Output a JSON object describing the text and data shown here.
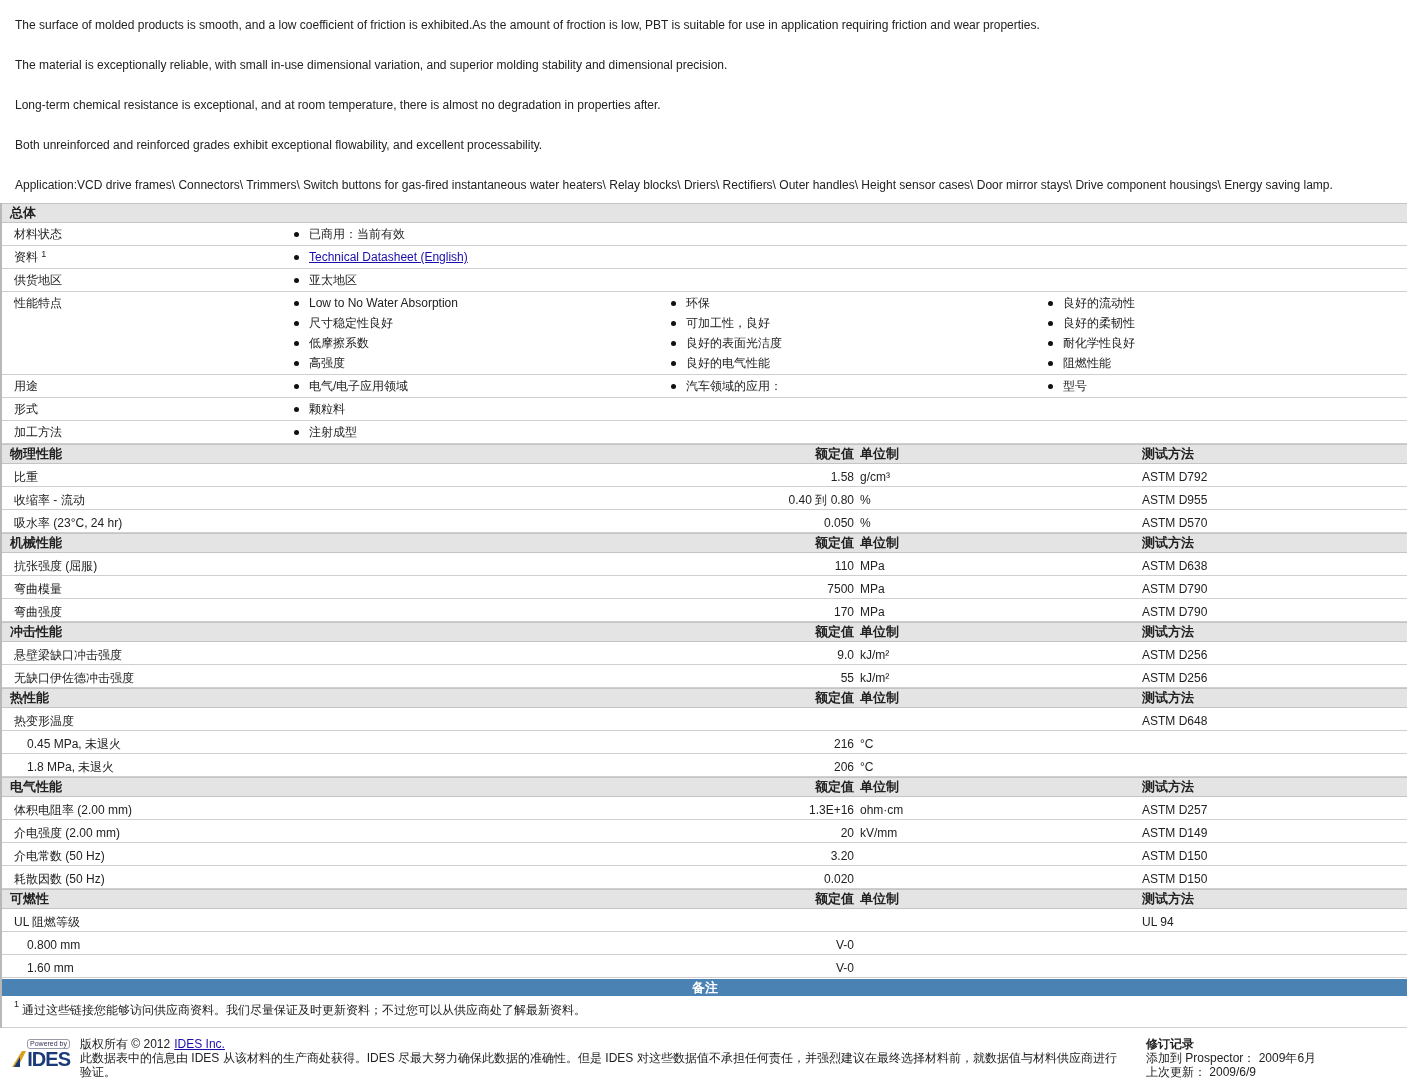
{
  "paragraphs": [
    "The surface of molded products is smooth, and a low coefficient of friction is exhibited.As the amount of froction is low, PBT is suitable for use in application requiring friction and wear properties.",
    "The material is exceptionally reliable, with small in-use dimensional variation, and superior molding stability and dimensional precision.",
    "Long-term chemical resistance is exceptional, and at room temperature, there is almost no degradation in properties after.",
    "Both unreinforced and reinforced grades exhibit exceptional flowability, and excellent processability.",
    "Application:VCD drive frames\\ Connectors\\ Trimmers\\ Switch buttons for gas-fired instantaneous water heaters\\ Relay blocks\\ Driers\\ Rectifiers\\ Outer handles\\ Height sensor cases\\ Door mirror stays\\ Drive component housings\\ Energy saving lamp."
  ],
  "general": {
    "title": "总体",
    "rows": [
      {
        "label": "材料状态",
        "columns": [
          [
            {
              "kind": "text",
              "text": "已商用：当前有效"
            }
          ]
        ]
      },
      {
        "label": "资料 $^{1}$",
        "columns": [
          [
            {
              "kind": "link",
              "text": "Technical Datasheet (English)"
            }
          ]
        ]
      },
      {
        "label": "供货地区",
        "columns": [
          [
            {
              "kind": "text",
              "text": "亚太地区"
            }
          ]
        ]
      },
      {
        "label": "性能特点",
        "columns": [
          [
            {
              "kind": "text",
              "text": "Low to No Water Absorption"
            },
            {
              "kind": "text",
              "text": "尺寸稳定性良好"
            },
            {
              "kind": "text",
              "text": "低摩擦系数"
            },
            {
              "kind": "text",
              "text": "高强度"
            }
          ],
          [
            {
              "kind": "text",
              "text": "环保"
            },
            {
              "kind": "text",
              "text": "可加工性，良好"
            },
            {
              "kind": "text",
              "text": "良好的表面光洁度"
            },
            {
              "kind": "text",
              "text": "良好的电气性能"
            }
          ],
          [
            {
              "kind": "text",
              "text": "良好的流动性"
            },
            {
              "kind": "text",
              "text": "良好的柔韧性"
            },
            {
              "kind": "text",
              "text": "耐化学性良好"
            },
            {
              "kind": "text",
              "text": "阻燃性能"
            }
          ]
        ]
      },
      {
        "label": "用途",
        "columns": [
          [
            {
              "kind": "text",
              "text": "电气/电子应用领域"
            }
          ],
          [
            {
              "kind": "text",
              "text": "汽车领域的应用："
            }
          ],
          [
            {
              "kind": "text",
              "text": "型号"
            }
          ]
        ]
      },
      {
        "label": "形式",
        "columns": [
          [
            {
              "kind": "text",
              "text": "颗粒料"
            }
          ]
        ]
      },
      {
        "label": "加工方法",
        "columns": [
          [
            {
              "kind": "text",
              "text": "注射成型"
            }
          ]
        ]
      }
    ]
  },
  "sections": [
    {
      "title": "物理性能",
      "headers": {
        "value": "额定值",
        "unit": "单位制",
        "method": "测试方法"
      },
      "rows": [
        {
          "label": "比重",
          "indented": false,
          "value": "1.58",
          "unit": "g/cm³",
          "method": "ASTM D792"
        },
        {
          "label": "收缩率 - 流动",
          "indented": false,
          "value": "0.40 到  0.80",
          "unit": "%",
          "method": "ASTM D955"
        },
        {
          "label": "吸水率 (23°C, 24 hr)",
          "indented": false,
          "value": "0.050",
          "unit": "%",
          "method": "ASTM D570"
        }
      ]
    },
    {
      "title": "机械性能",
      "headers": {
        "value": "额定值",
        "unit": "单位制",
        "method": "测试方法"
      },
      "rows": [
        {
          "label": "抗张强度 (屈服)",
          "indented": false,
          "value": "110",
          "unit": "MPa",
          "method": "ASTM D638"
        },
        {
          "label": "弯曲模量",
          "indented": false,
          "value": "7500",
          "unit": "MPa",
          "method": "ASTM D790"
        },
        {
          "label": "弯曲强度",
          "indented": false,
          "value": "170",
          "unit": "MPa",
          "method": "ASTM D790"
        }
      ]
    },
    {
      "title": "冲击性能",
      "headers": {
        "value": "额定值",
        "unit": "单位制",
        "method": "测试方法"
      },
      "rows": [
        {
          "label": "悬壁梁缺口冲击强度",
          "indented": false,
          "value": "9.0",
          "unit": "kJ/m²",
          "method": "ASTM D256"
        },
        {
          "label": "无缺口伊佐德冲击强度",
          "indented": false,
          "value": "55",
          "unit": "kJ/m²",
          "method": "ASTM D256"
        }
      ]
    },
    {
      "title": "热性能",
      "headers": {
        "value": "额定值",
        "unit": "单位制",
        "method": "测试方法"
      },
      "rows": [
        {
          "label": "热变形温度",
          "indented": false,
          "method": "ASTM D648"
        },
        {
          "label": "0.45 MPa, 未退火",
          "indented": true,
          "value": "216",
          "unit": "°C"
        },
        {
          "label": "1.8 MPa, 未退火",
          "indented": true,
          "value": "206",
          "unit": "°C"
        }
      ]
    },
    {
      "title": "电气性能",
      "headers": {
        "value": "额定值",
        "unit": "单位制",
        "method": "测试方法"
      },
      "rows": [
        {
          "label": "体积电阻率 (2.00 mm)",
          "indented": false,
          "value": "1.3E+16",
          "unit": "ohm·cm",
          "method": "ASTM D257"
        },
        {
          "label": "介电强度 (2.00 mm)",
          "indented": false,
          "value": "20",
          "unit": "kV/mm",
          "method": "ASTM D149"
        },
        {
          "label": "介电常数 (50 Hz)",
          "indented": false,
          "value": "3.20",
          "method": "ASTM D150"
        },
        {
          "label": "耗散因数 (50 Hz)",
          "indented": false,
          "value": "0.020",
          "method": "ASTM D150"
        }
      ]
    },
    {
      "title": "可燃性",
      "headers": {
        "value": "额定值",
        "unit": "单位制",
        "method": "测试方法"
      },
      "rows": [
        {
          "label": "UL 阻燃等级",
          "indented": false,
          "method": "UL 94"
        },
        {
          "label": "0.800 mm",
          "indented": true,
          "value": "V-0"
        },
        {
          "label": "1.60 mm",
          "indented": true,
          "value": "V-0"
        }
      ]
    }
  ],
  "notes": {
    "title": "备注",
    "footnote": "$^{1}$ 通过这些链接您能够访问供应商资料。我们尽量保证及时更新资料；不过您可以从供应商处了解最新资料。"
  },
  "footer": {
    "logo": {
      "caption": "Powered by",
      "name": "IDES"
    },
    "copyright": "版权所有 © 2012",
    "company_link": "IDES Inc.",
    "disclaimer": "此数据表中的信息由 IDES 从该材料的生产商处获得。IDES 尽最大努力确保此数据的准确性。但是 IDES 对这些数据值不承担任何责任，并强烈建议在最终选择材料前，就数据值与材料供应商进行验证。",
    "revision": {
      "title": "修订记录",
      "lines": [
        "添加到 Prospector： 2009年6月",
        "上次更新： 2009/6/9"
      ]
    }
  }
}
